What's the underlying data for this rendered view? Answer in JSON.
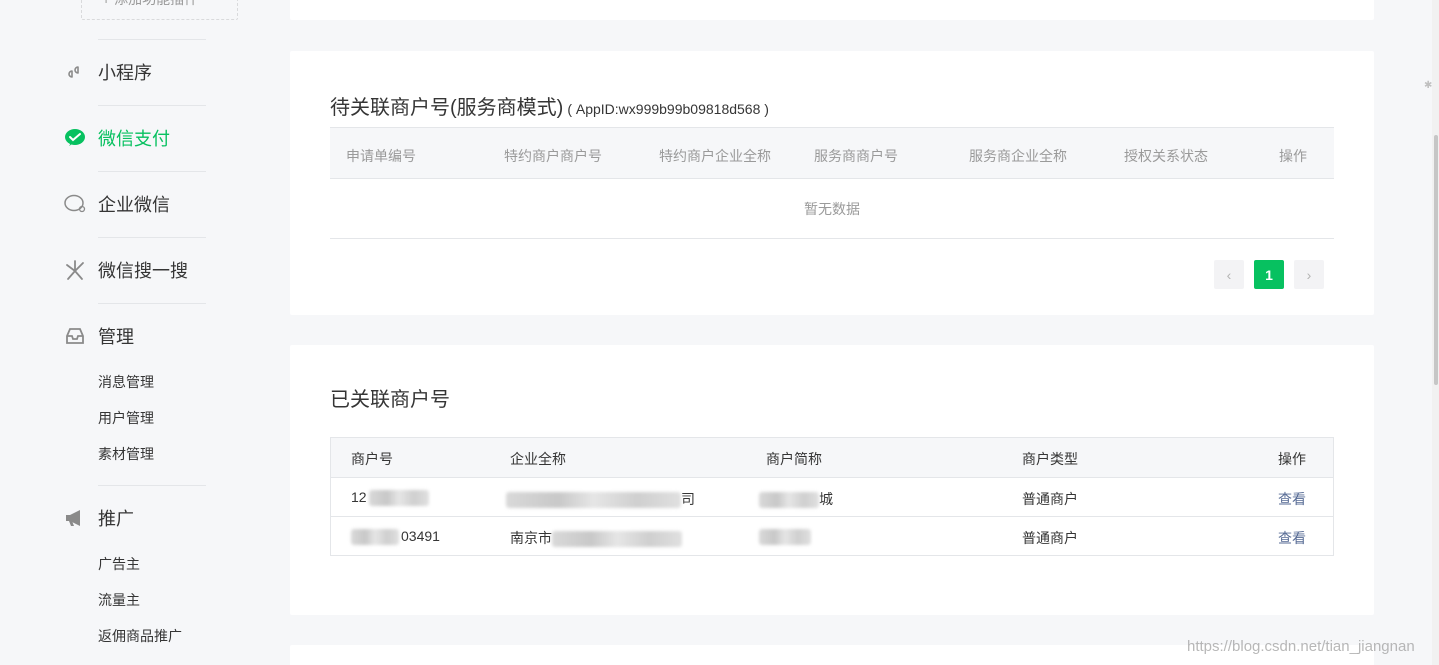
{
  "sidebar": {
    "add_plugin": "+ 添加功能插件",
    "items": [
      {
        "label": "小程序",
        "icon": "mini-program-icon"
      },
      {
        "label": "微信支付",
        "icon": "wechat-pay-icon",
        "active": true
      },
      {
        "label": "企业微信",
        "icon": "work-wechat-icon"
      },
      {
        "label": "微信搜一搜",
        "icon": "wechat-search-icon"
      },
      {
        "label": "管理",
        "icon": "inbox-icon"
      },
      {
        "label": "推广",
        "icon": "megaphone-icon"
      }
    ],
    "manage_sub": [
      "消息管理",
      "用户管理",
      "素材管理"
    ],
    "promote_sub": [
      "广告主",
      "流量主",
      "返佣商品推广"
    ]
  },
  "pending": {
    "title": "待关联商户号(服务商模式)",
    "appid": "( AppID:wx999b99b09818d568 )",
    "columns": [
      "申请单编号",
      "特约商户商户号",
      "特约商户企业全称",
      "服务商商户号",
      "服务商企业全称",
      "授权关系状态",
      "操作"
    ],
    "empty_text": "暂无数据",
    "pagination": {
      "prev": "‹",
      "current": "1",
      "next": "›"
    }
  },
  "linked": {
    "title": "已关联商户号",
    "columns": [
      "商户号",
      "企业全称",
      "商户简称",
      "商户类型",
      "操作"
    ],
    "rows": [
      {
        "merchant_id": "12",
        "company": "司",
        "short_name": "城",
        "type": "普通商户",
        "action": "查看"
      },
      {
        "merchant_id": "03491",
        "company": "南京市",
        "short_name": "",
        "type": "普通商户",
        "action": "查看"
      }
    ]
  },
  "watermark": "https://blog.csdn.net/tian_jiangnan",
  "colors": {
    "accent": "#07c160",
    "link": "#576b95"
  }
}
